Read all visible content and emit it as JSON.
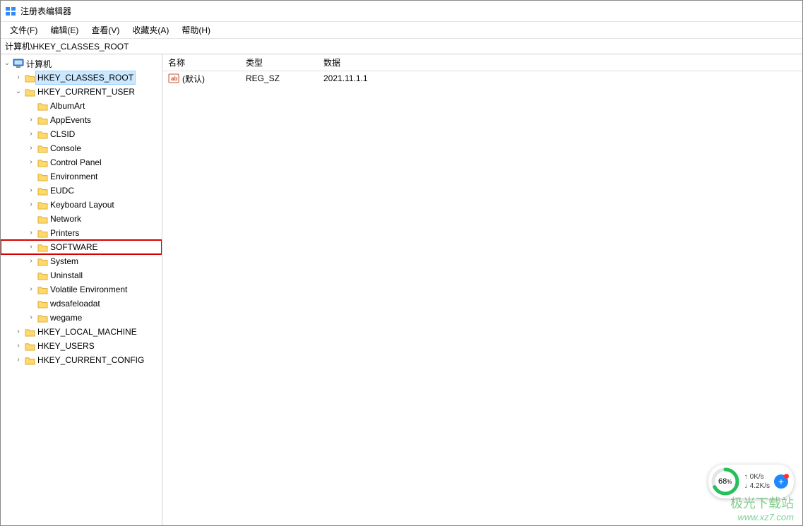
{
  "window": {
    "title": "注册表编辑器"
  },
  "menus": {
    "file": "文件(F)",
    "edit": "编辑(E)",
    "view": "查看(V)",
    "favorites": "收藏夹(A)",
    "help": "帮助(H)"
  },
  "address": "计算机\\HKEY_CLASSES_ROOT",
  "tree": {
    "root": "计算机",
    "hives": {
      "hkcr": "HKEY_CLASSES_ROOT",
      "hkcu": "HKEY_CURRENT_USER",
      "hklm": "HKEY_LOCAL_MACHINE",
      "hku": "HKEY_USERS",
      "hkcc": "HKEY_CURRENT_CONFIG"
    },
    "hkcu_children": {
      "albumart": "AlbumArt",
      "appevents": "AppEvents",
      "clsid": "CLSID",
      "console": "Console",
      "controlpanel": "Control Panel",
      "environment": "Environment",
      "eudc": "EUDC",
      "keyboard": "Keyboard Layout",
      "network": "Network",
      "printers": "Printers",
      "software": "SOFTWARE",
      "system": "System",
      "uninstall": "Uninstall",
      "volatile": "Volatile Environment",
      "wdsafeloadat": "wdsafeloadat",
      "wegame": "wegame"
    }
  },
  "list": {
    "headers": {
      "name": "名称",
      "type": "类型",
      "data": "数据"
    },
    "rows": [
      {
        "name": "(默认)",
        "type": "REG_SZ",
        "data": "2021.11.1.1"
      }
    ]
  },
  "perf": {
    "percent": "68",
    "percent_unit": "%",
    "up": "0K/s",
    "down": "4.2K/s"
  },
  "watermark": {
    "line1": "极光下载站",
    "line2": "www.xz7.com"
  }
}
